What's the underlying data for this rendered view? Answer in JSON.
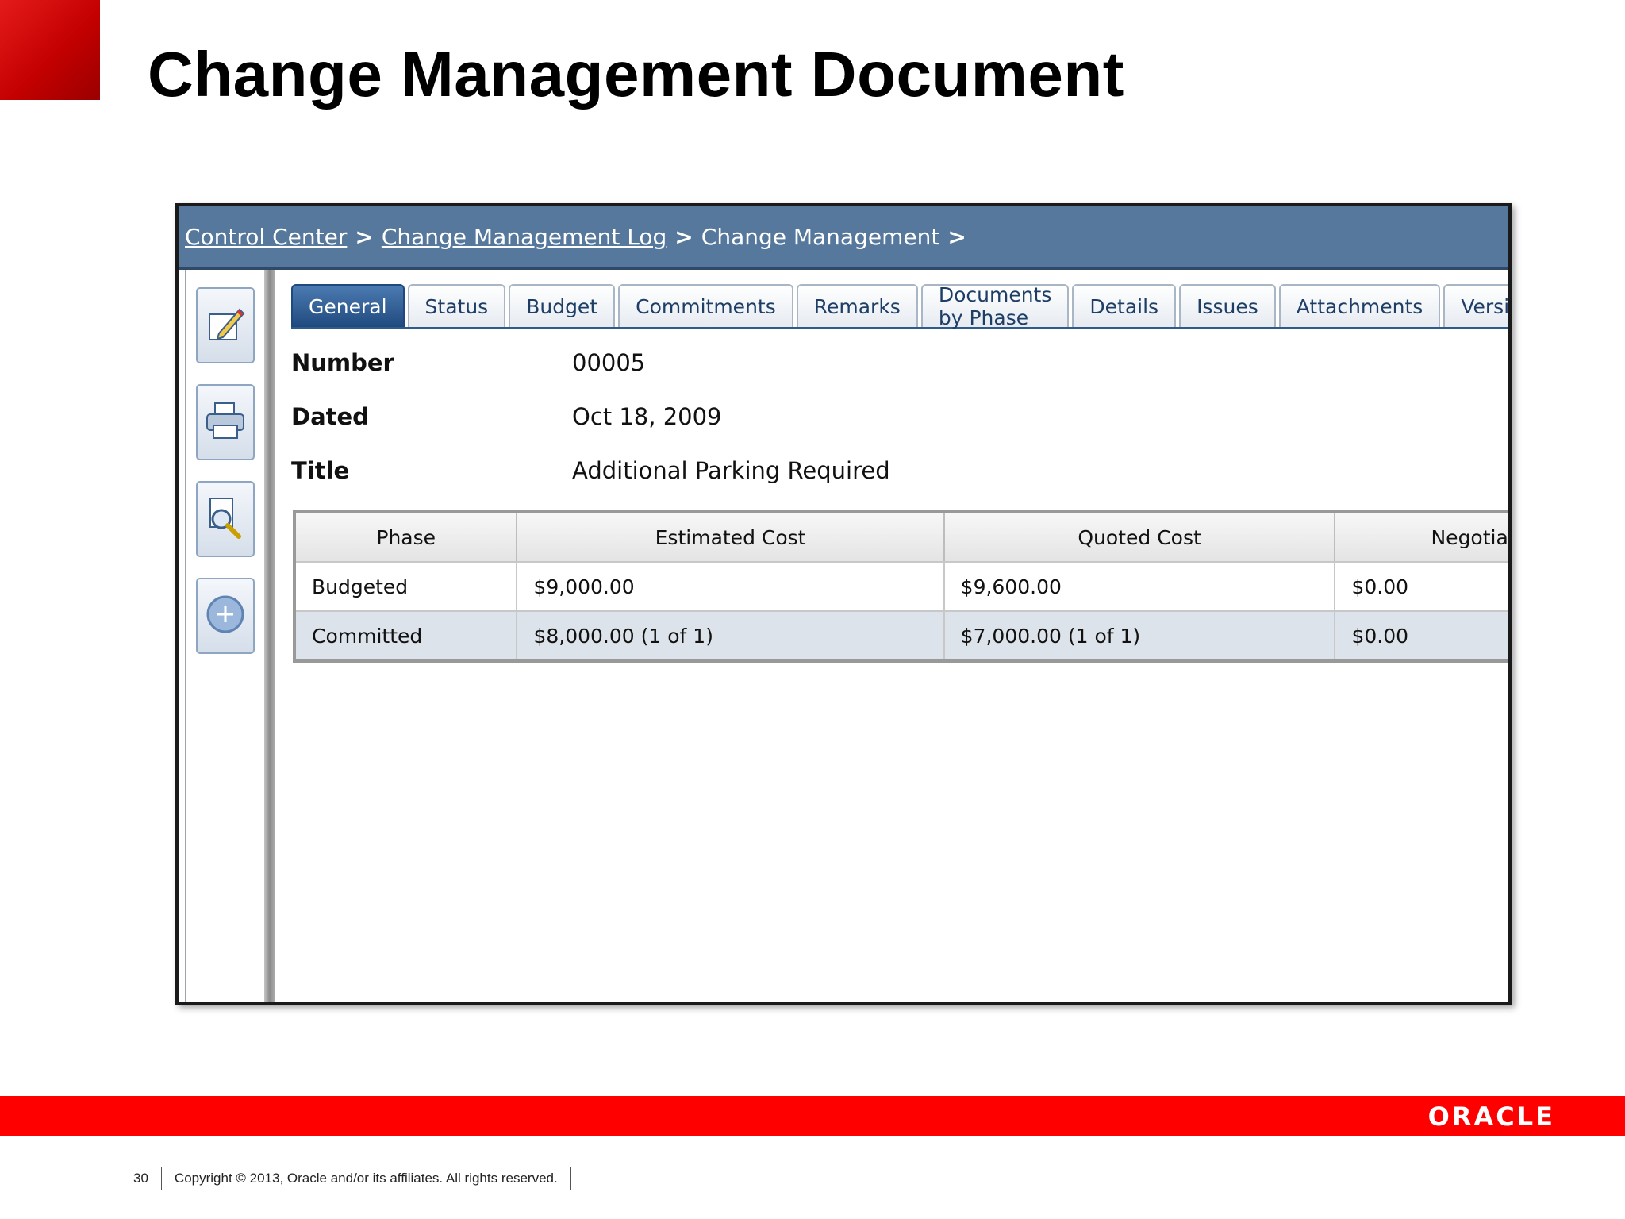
{
  "slide": {
    "title": "Change Management Document",
    "page_number": "30",
    "copyright": "Copyright © 2013, Oracle and/or its affiliates. All rights reserved.",
    "logo_text": "ORACLE"
  },
  "breadcrumb": {
    "items": [
      "Control Center",
      "Change Management Log"
    ],
    "current": "Change Management",
    "separator": ">"
  },
  "toolbar": {
    "buttons": [
      {
        "icon": "edit-icon"
      },
      {
        "icon": "print-icon"
      },
      {
        "icon": "preview-icon"
      },
      {
        "icon": "add-icon"
      }
    ]
  },
  "tabs": [
    "General",
    "Status",
    "Budget",
    "Commitments",
    "Remarks",
    "Documents by Phase",
    "Details",
    "Issues",
    "Attachments",
    "Versions"
  ],
  "active_tab": "General",
  "fields": {
    "number_label": "Number",
    "number_value": "00005",
    "dated_label": "Dated",
    "dated_value": "Oct 18, 2009",
    "title_label": "Title",
    "title_value": "Additional Parking Required"
  },
  "grid": {
    "headers": [
      "Phase",
      "Estimated Cost",
      "Quoted Cost",
      "Negotiate"
    ],
    "rows": [
      [
        "Budgeted",
        "$9,000.00",
        "$9,600.00",
        "$0.00"
      ],
      [
        "Committed",
        "$8,000.00  (1 of 1)",
        "$7,000.00  (1 of 1)",
        "$0.00"
      ]
    ]
  },
  "colors": {
    "header_bar": "#56789c",
    "active_tab": "#1f4a7f",
    "brand_red": "#ff0000"
  }
}
